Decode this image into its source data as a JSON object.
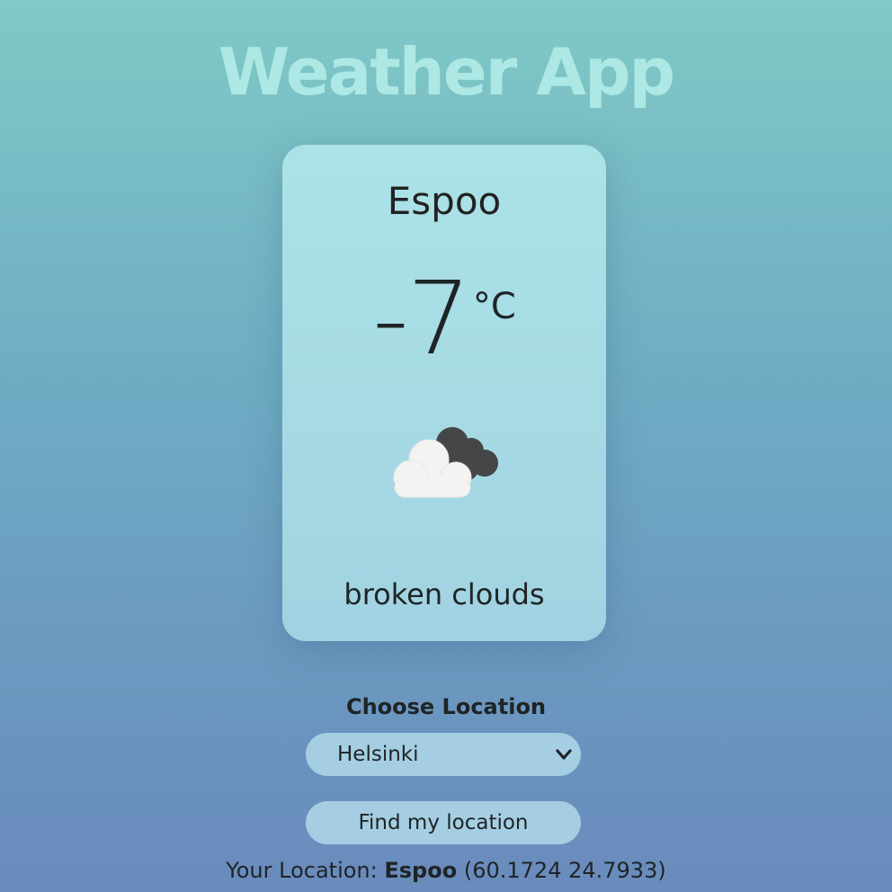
{
  "app": {
    "title": "Weather App"
  },
  "weather": {
    "city": "Espoo",
    "temperature": "-7",
    "unit": "°C",
    "icon": "broken-clouds-icon",
    "description": "broken clouds"
  },
  "location_picker": {
    "label": "Choose Location",
    "selected": "Helsinki",
    "find_button": "Find my location"
  },
  "your_location": {
    "prefix": "Your Location:",
    "city": "Espoo",
    "coords": "(60.1724 24.7933)"
  },
  "colors": {
    "background_top": "#80c9c6",
    "background_bottom": "#6a8bbd",
    "card": "#a7dbe4",
    "control": "#a5cee2",
    "title": "#ade8e4"
  }
}
